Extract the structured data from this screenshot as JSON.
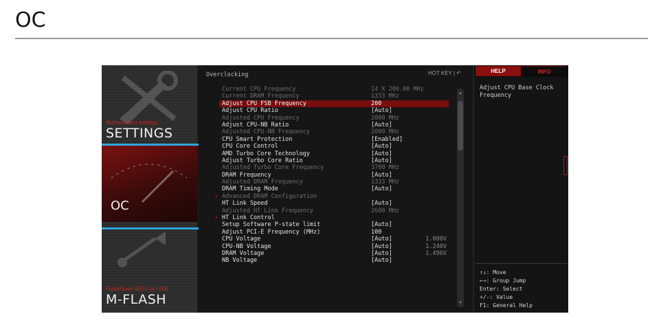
{
  "doc": {
    "heading": "OC"
  },
  "nav": {
    "settings": {
      "small": "Motherboard settings",
      "big": "SETTINGS"
    },
    "oc": {
      "big": "OC"
    },
    "mflash": {
      "small": "Flash/Save BIOS by USB",
      "big": "M-FLASH"
    }
  },
  "main": {
    "title": "Overclocking",
    "hotkey": "HOT KEY  |  ↶",
    "rows": [
      {
        "label": "Current CPU Frequency",
        "value": "14 X 200.00 MHz",
        "style": "dim"
      },
      {
        "label": "Current DRAM Frequency",
        "value": "1333 MHz",
        "style": "dim"
      },
      {
        "label": "Adjust CPU FSB Frequency",
        "value": "200",
        "style": "sel"
      },
      {
        "label": "Adjust CPU Ratio",
        "value": "[Auto]",
        "style": "normal"
      },
      {
        "label": "Adjusted CPU Frequency",
        "value": "2800 MHz",
        "style": "dim"
      },
      {
        "label": "Adjust CPU-NB Ratio",
        "value": "[Auto]",
        "style": "normal"
      },
      {
        "label": "Adjusted CPU-NB Frequency",
        "value": "2000 MHz",
        "style": "dim"
      },
      {
        "label": "CPU Smart Protection",
        "value": "[Enabled]",
        "style": "normal"
      },
      {
        "label": "CPU Core Control",
        "value": "[Auto]",
        "style": "normal"
      },
      {
        "label": "AMD Turbo Core Technology",
        "value": "[Auto]",
        "style": "normal"
      },
      {
        "label": "Adjust Turbo Core Ratio",
        "value": "[Auto]",
        "style": "normal"
      },
      {
        "label": "Adjusted Turbo Core Frequency",
        "value": "3700 MHz",
        "style": "dim"
      },
      {
        "label": "DRAM Frequency",
        "value": "[Auto]",
        "style": "normal"
      },
      {
        "label": "Adjusted DRAM Frequency",
        "value": "1333 MHz",
        "style": "dim"
      },
      {
        "label": "DRAM Timing Mode",
        "value": "[Auto]",
        "style": "normal"
      },
      {
        "label": "Advanced DRAM Configuration",
        "value": "",
        "style": "dim",
        "arrow": true
      },
      {
        "label": "HT Link Speed",
        "value": "[Auto]",
        "style": "normal"
      },
      {
        "label": "Adjusted HT Link Frequency",
        "value": "2600 MHz",
        "style": "dim"
      },
      {
        "label": "HT Link Control",
        "value": "",
        "style": "normal",
        "arrow": true
      },
      {
        "label": "Setup Software P-state limit",
        "value": "[Auto]",
        "style": "normal"
      },
      {
        "label": "Adjust PCI-E Frequency (MHz)",
        "value": "100",
        "style": "normal"
      },
      {
        "label": "CPU Voltage",
        "mid": "1.008V",
        "value": "[Auto]",
        "style": "normal"
      },
      {
        "label": "CPU-NB Voltage",
        "mid": "1.240V",
        "value": "[Auto]",
        "style": "normal"
      },
      {
        "label": "DRAM Voltage",
        "mid": "1.496V",
        "value": "[Auto]",
        "style": "normal"
      },
      {
        "label": "NB Voltage",
        "value": "[Auto]",
        "style": "normal"
      }
    ]
  },
  "help": {
    "tab_help": "HELP",
    "tab_info": "INFO",
    "text": "Adjust CPU Base Clock Frequency",
    "keys": [
      "↑↓: Move",
      "←→: Group Jump",
      "Enter: Select",
      "+/-: Value",
      "F1: General Help"
    ]
  },
  "colors": {
    "accent": "#c3261f",
    "selection": "#7a0d0d",
    "highlight_frame": "#2fa6e0"
  },
  "icons": [
    "tools-icon",
    "gauge-icon",
    "usb-icon",
    "arrow-right-icon",
    "undo-icon"
  ]
}
